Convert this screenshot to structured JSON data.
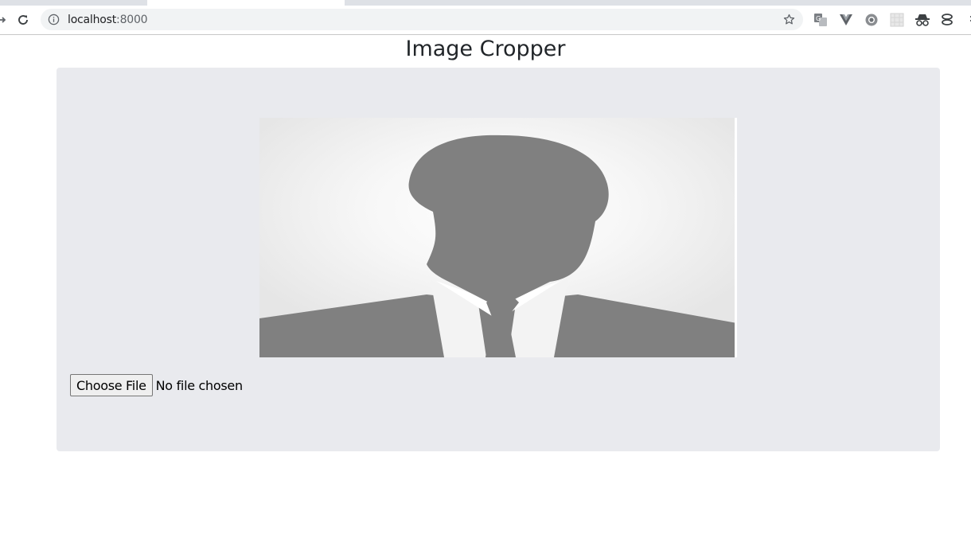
{
  "browser": {
    "url_host": "localhost",
    "url_port": ":8000",
    "extension_icons": [
      "translate-icon",
      "vue-devtools-icon",
      "chrome-extension-icon",
      "grid-extension-icon",
      "incognito-spy-icon",
      "stack-extension-icon"
    ]
  },
  "page": {
    "title": "Image Cropper"
  },
  "uploader": {
    "button_label": "Choose File",
    "status_text": "No file chosen"
  },
  "preview": {
    "image_icon": "default-avatar-silhouette"
  }
}
